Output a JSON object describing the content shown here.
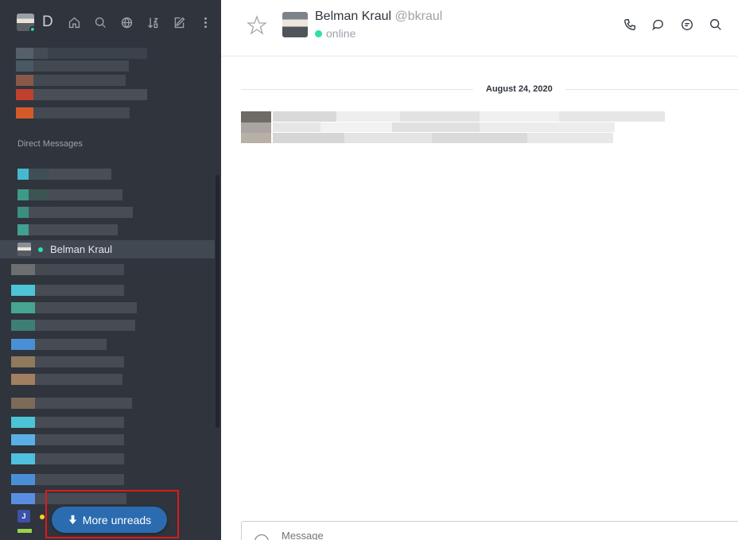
{
  "sidebar": {
    "header_letter": "D",
    "section_title": "Direct Messages",
    "active_dm": {
      "name": "Belman Kraul"
    },
    "more_unreads_label": "More unreads",
    "j_initial": "J"
  },
  "room": {
    "name": "Belman Kraul",
    "handle": "@bkraul",
    "status": "online",
    "date_divider": "August 24, 2020",
    "composer_placeholder": "Message"
  },
  "colors": {
    "sidebar_bg": "#2f343d",
    "online": "#2de0a5",
    "more_unreads_bg": "#2b6cb0",
    "highlight_frame": "#e01919"
  }
}
